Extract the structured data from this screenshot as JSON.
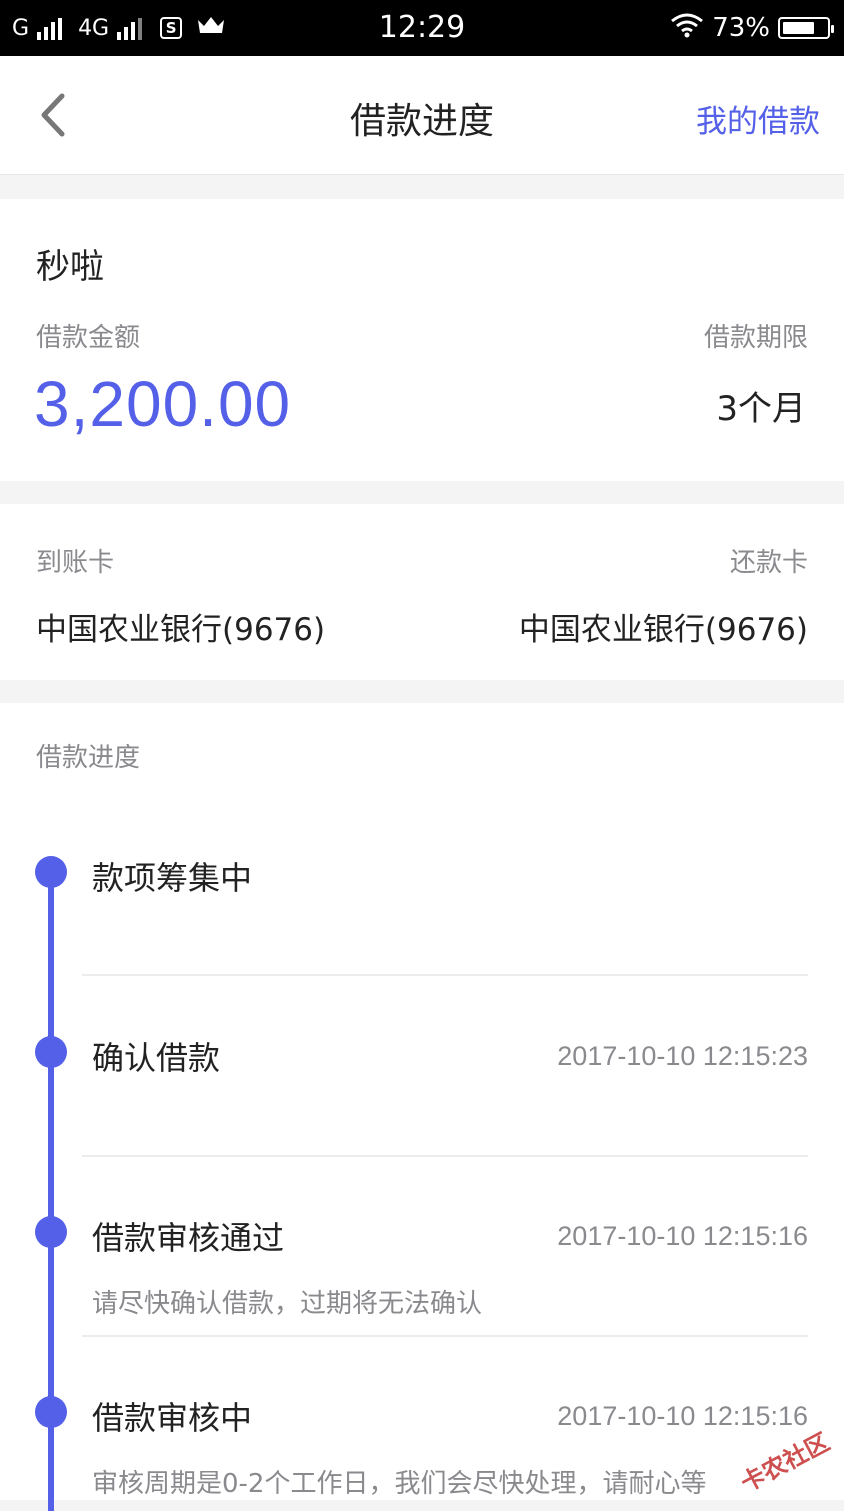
{
  "statusbar": {
    "carrier1": "G",
    "carrier2": "4G",
    "sim_icon_label": "S",
    "time": "12:29",
    "battery_percent": "73%",
    "battery_level": 0.73
  },
  "navbar": {
    "title": "借款进度",
    "right_link": "我的借款"
  },
  "loan": {
    "product_name": "秒啦",
    "amount_label": "借款金额",
    "amount": "3,200.00",
    "term_label": "借款期限",
    "term": "3个月"
  },
  "cards": {
    "receive_label": "到账卡",
    "receive_bank": "中国农业银行(9676)",
    "repay_label": "还款卡",
    "repay_bank": "中国农业银行(9676)"
  },
  "progress": {
    "section_label": "借款进度",
    "steps": [
      {
        "title": "款项筹集中",
        "time": "",
        "desc": ""
      },
      {
        "title": "确认借款",
        "time": "2017-10-10 12:15:23",
        "desc": ""
      },
      {
        "title": "借款审核通过",
        "time": "2017-10-10 12:15:16",
        "desc": "请尽快确认借款，过期将无法确认"
      },
      {
        "title": "借款审核中",
        "time": "2017-10-10 12:15:16",
        "desc": "审核周期是0-2个工作日，我们会尽快处理，请耐心等"
      }
    ]
  },
  "watermark": "卡农社区",
  "colors": {
    "accent": "#5460e8",
    "muted": "#8a8a8e",
    "background": "#f4f4f5"
  }
}
